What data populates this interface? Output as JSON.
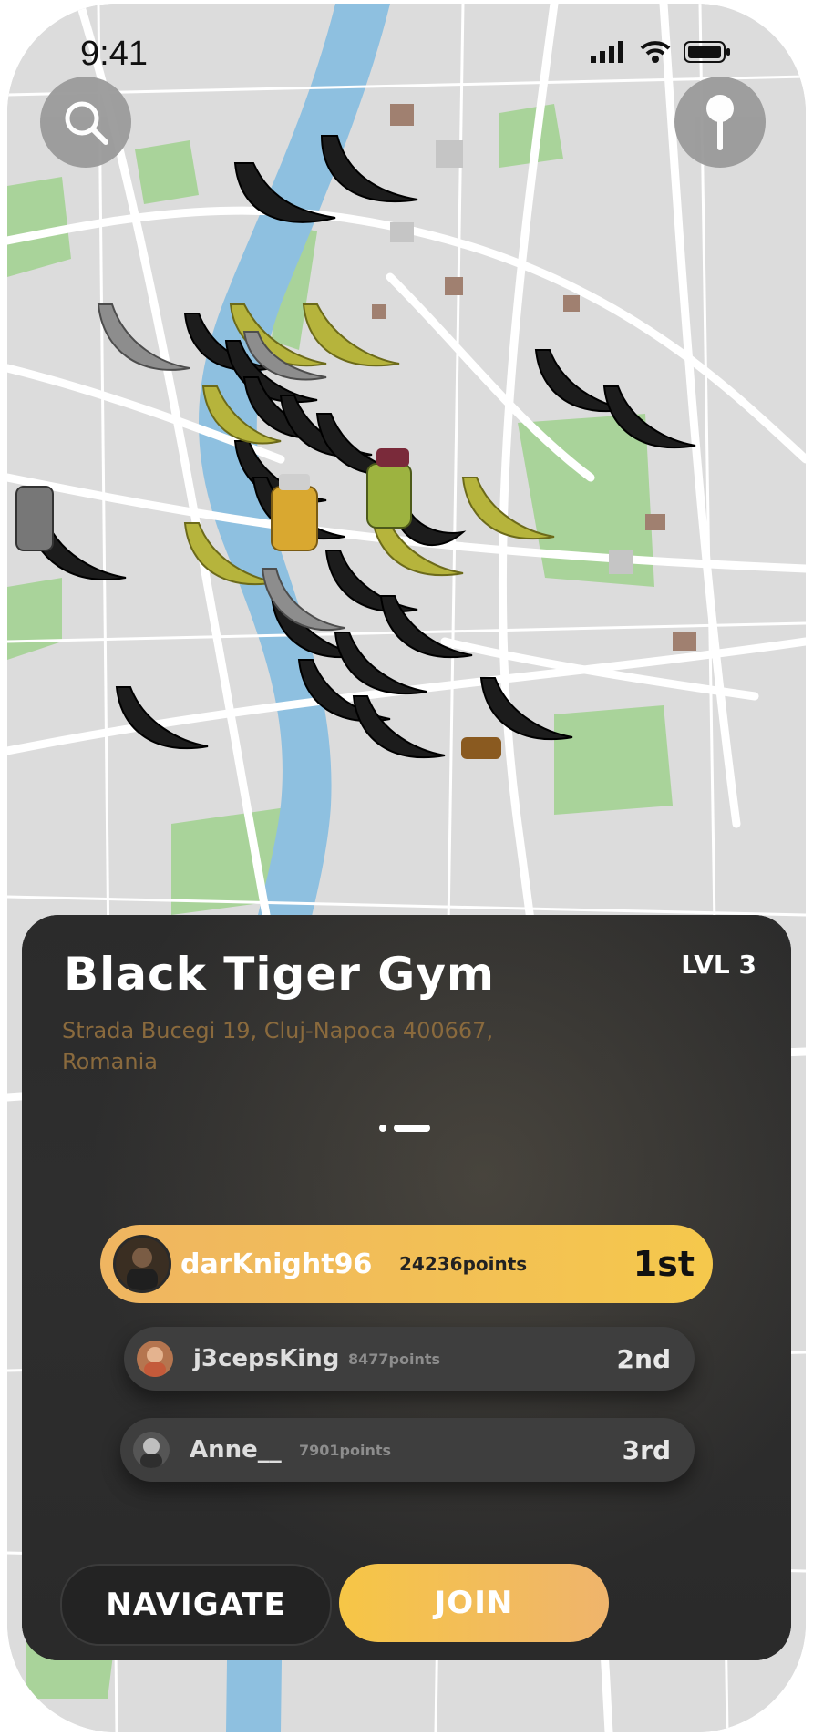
{
  "status_bar": {
    "time": "9:41"
  },
  "map": {
    "marker_types": [
      "banana-black",
      "banana-yellow",
      "banana-gray",
      "supplement-jar"
    ]
  },
  "venue": {
    "name": "Black Tiger Gym",
    "level": "LVL 3",
    "address": "Strada Bucegi 19, Cluj-Napoca 400667, Romania"
  },
  "leaderboard": [
    {
      "name": "darKnight96",
      "points": "24236points",
      "rank": "1st"
    },
    {
      "name": "j3cepsKing",
      "points": "8477points",
      "rank": "2nd"
    },
    {
      "name": "Anne__",
      "points": "7901points",
      "rank": "3rd"
    }
  ],
  "actions": {
    "navigate_label": "NAVIGATE",
    "join_label": "JOIN"
  },
  "colors": {
    "accent": "#F5C84C",
    "accent_alt": "#EFB46C",
    "sheet_bg": "#262626",
    "water": "#8EC0E0",
    "park": "#A9D39A"
  }
}
